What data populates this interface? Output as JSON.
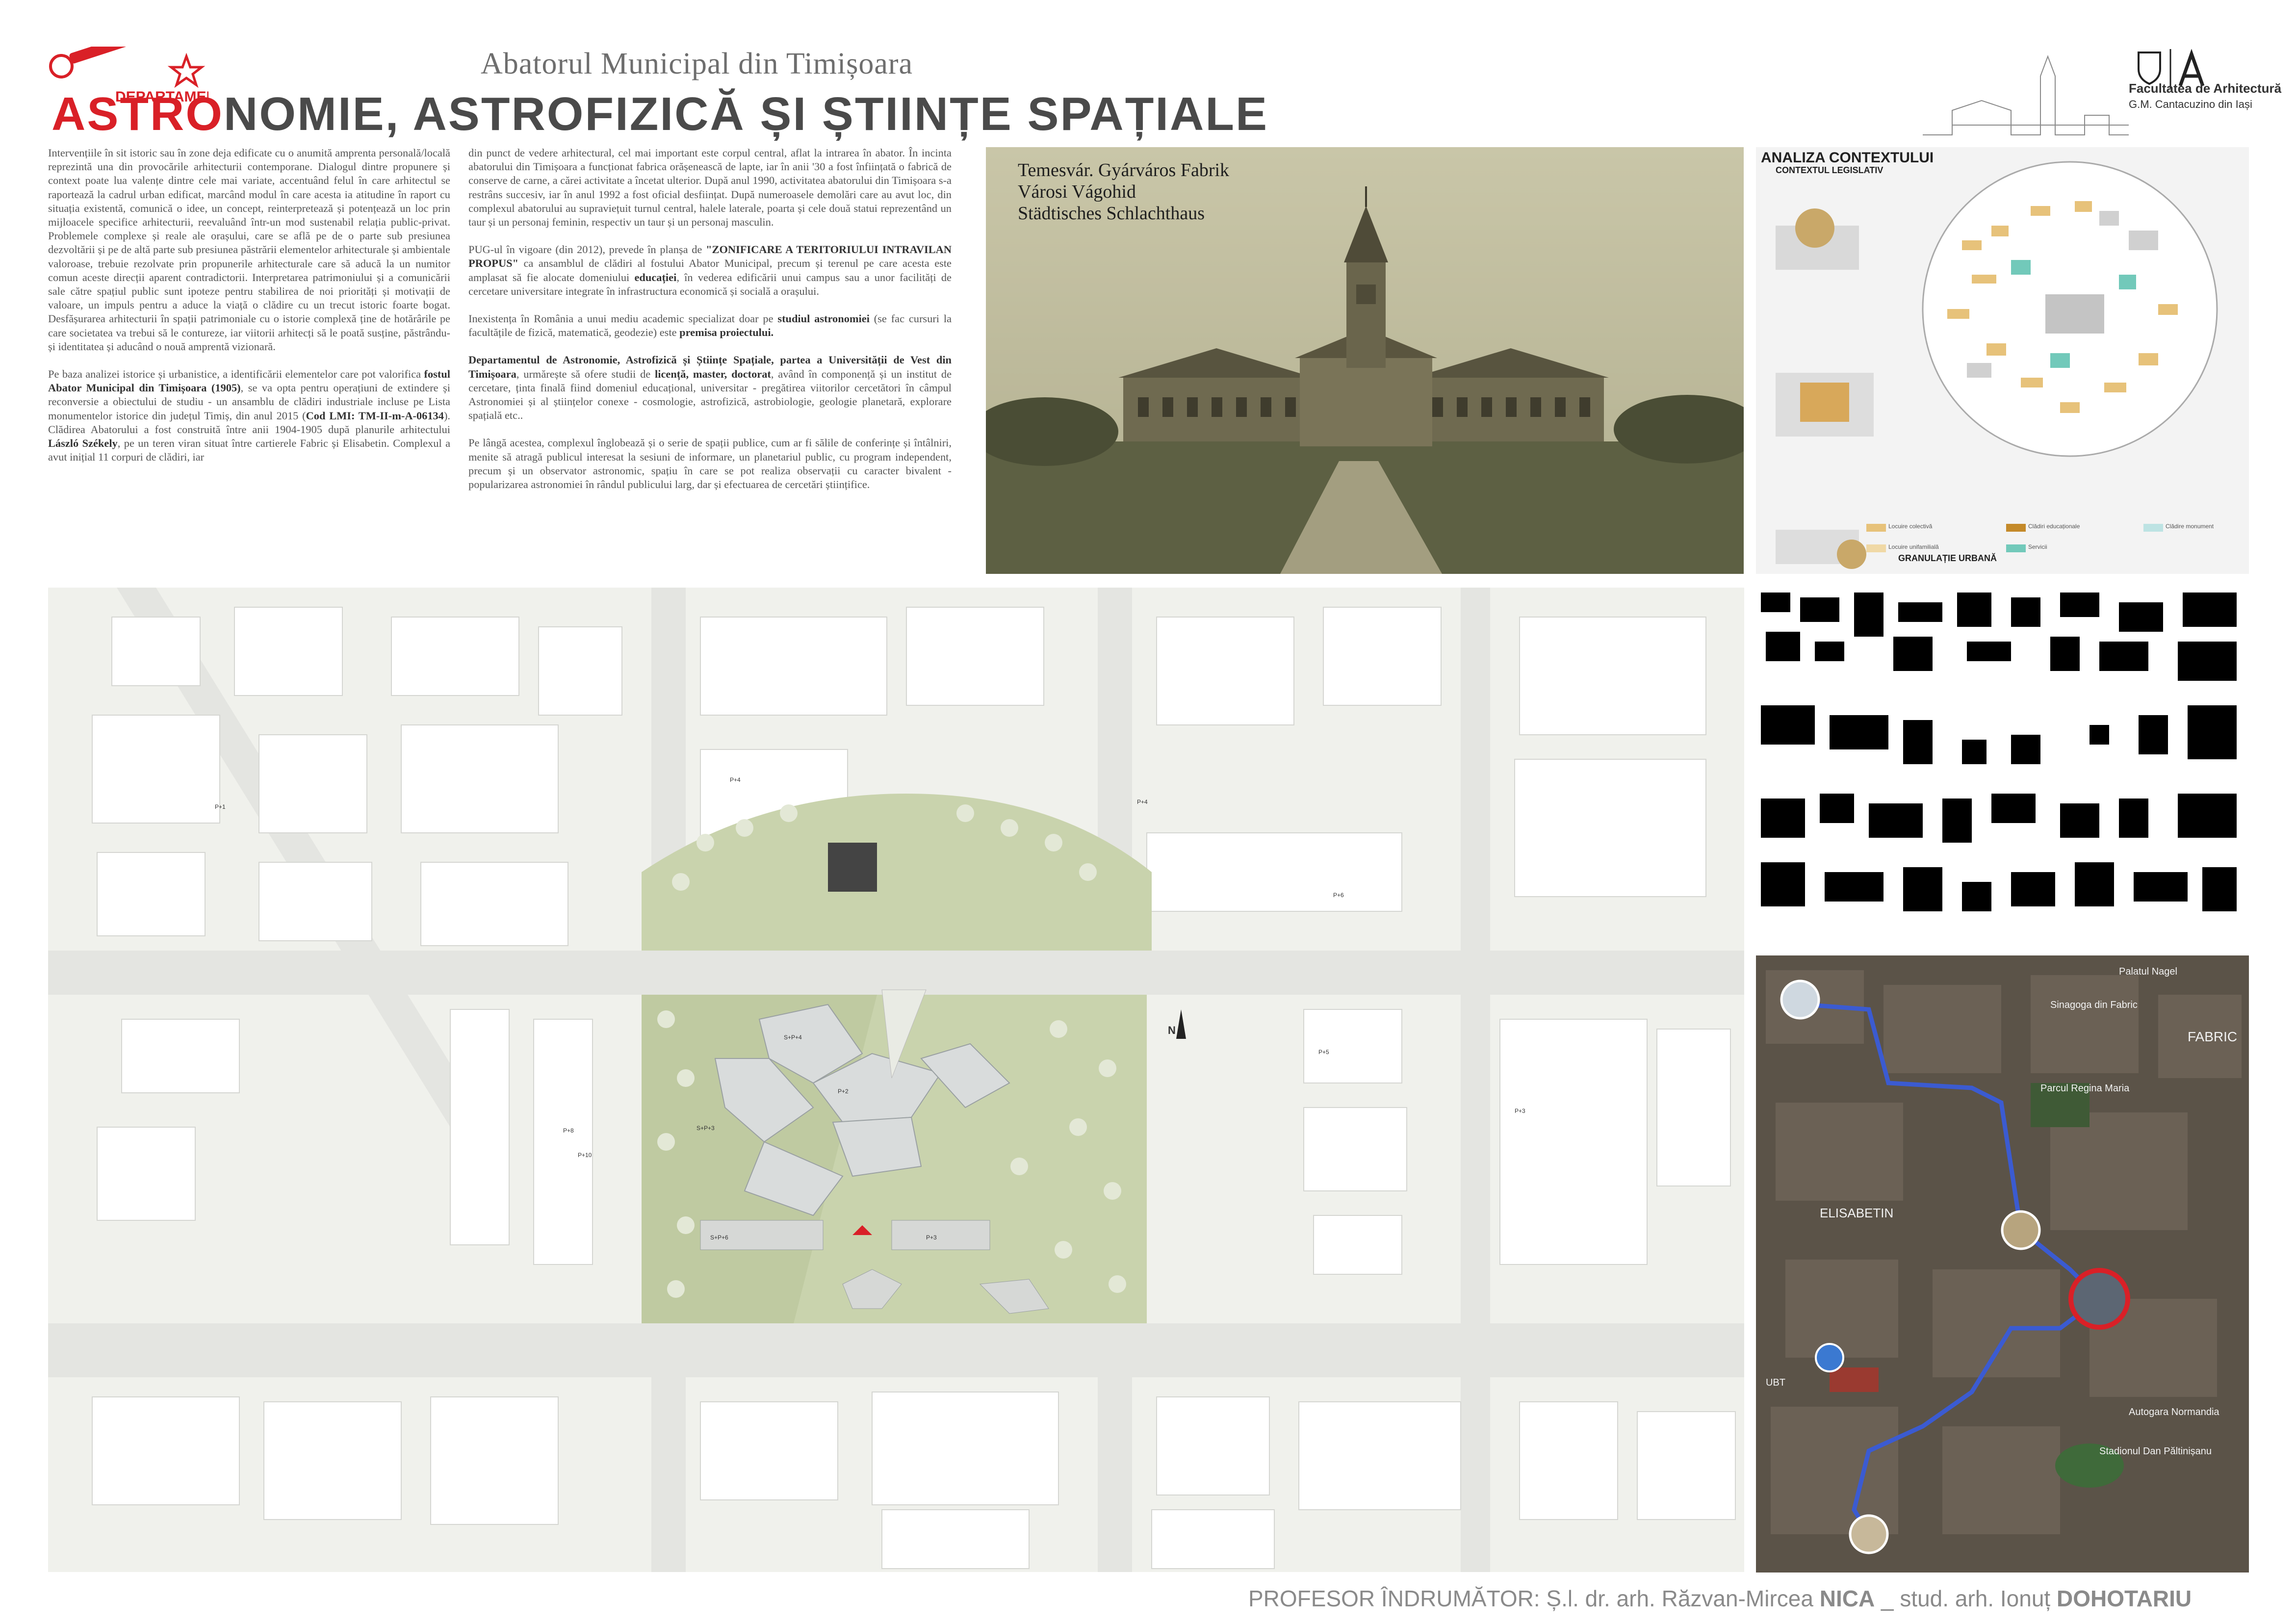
{
  "header": {
    "logo_text": "DEPARTAMENTUL",
    "subtitle": "Abatorul Municipal din Timișoara",
    "title_red": "ASTRO",
    "title_rest": "NOMIE, ASTROFIZICĂ ȘI ȘTIINȚE SPAȚIALE",
    "faculty_name": "Facultatea de Arhitectură",
    "faculty_sub": "G.M. Cantacuzino din Iași"
  },
  "text": {
    "col1_p1": "Intervențiile în sit istoric sau în zone deja edificate cu o anumită amprenta personală/locală reprezintă una din provocările arhitecturii contemporane. Dialogul dintre propunere și context poate lua valențe dintre cele mai variate, accentuând felul în care arhitectul se raportează la cadrul urban edificat, marcând modul în care acesta ia atitudine în raport cu situația existentă, comunică o idee, un concept, reinterpretează și potențează un loc prin mijloacele specifice arhitecturii, reevaluând într-un mod sustenabil relația public-privat. Problemele complexe și reale ale orașului, care se află pe de o parte sub presiunea dezvoltării și pe de altă parte sub presiunea păstrării elementelor arhitecturale și ambientale valoroase, trebuie rezolvate prin propunerile arhitecturale care să aducă la un numitor comun aceste direcții aparent contradictorii. Interpretarea patrimoniului și a comunicării sale către spațiul public sunt ipoteze pentru stabilirea de noi priorități și motivații de valoare, un impuls pentru a aduce la viață o clădire cu un trecut istoric foarte bogat. Desfășurarea arhitecturii în spații patrimoniale cu o istorie complexă ține de hotărârile pe care societatea va trebui să le contureze, iar viitorii arhitecți să le poată susține, păstrându-și identitatea și aducând o nouă amprentă vizionară.",
    "col1_p2a": "Pe baza analizei istorice și urbanistice, a identificării elementelor care pot valorifica ",
    "col1_p2b": "fostul Abator Municipal din Timișoara (1905)",
    "col1_p2c": ", se va opta pentru operațiuni de extindere și reconversie a obiectului de studiu - un ansamblu de clădiri industriale incluse pe Lista monumentelor istorice din județul Timiș, din anul 2015 (",
    "col1_p2d": "Cod LMI: TM-II-m-A-06134",
    "col1_p2e": "). Clădirea Abatorului a fost construită între anii 1904-1905 după planurile arhitectului ",
    "col1_p2f": "László Székely",
    "col1_p2g": ", pe un teren viran situat între cartierele Fabric și Elisabetin. Complexul a avut inițial 11 corpuri de clădiri, iar",
    "col2_p1": "din punct de vedere arhitectural, cel mai important este corpul central, aflat la intrarea în abator. În incinta abatorului din Timișoara a funcționat fabrica orășenească de lapte, iar în anii '30 a fost înființată o fabrică de conserve de carne, a cărei activitate a încetat ulterior. După anul 1990, activitatea abatorului din Timișoara s-a restrâns succesiv, iar în anul 1992 a fost oficial desființat. După numeroasele demolări care au avut loc, din complexul abatorului au supraviețuit turnul central, halele laterale, poarta și cele două statui reprezentând un taur și un personaj feminin, respectiv un taur și un personaj masculin.",
    "col2_p2a": "PUG-ul în vigoare (din 2012), prevede în planșa de ",
    "col2_p2b": "\"ZONIFICARE A TERITORIULUI INTRAVILAN PROPUS\"",
    "col2_p2c": " ca ansamblul de clădiri al fostului Abator Municipal, precum și terenul pe care acesta este amplasat să fie alocate domeniului ",
    "col2_p2d": "educației",
    "col2_p2e": ", în vederea edificării unui campus sau a unor facilități de cercetare universitare integrate în infrastructura economică și socială a orașului.",
    "col2_p3a": "Inexistența în România a unui mediu academic specializat doar pe ",
    "col2_p3b": "studiul astronomiei",
    "col2_p3c": " (se fac cursuri la facultățile de fizică, matematică, geodezie) este ",
    "col2_p3d": "premisa proiectului.",
    "col2_p4a": "Departamentul de Astronomie, Astrofizică și Științe Spațiale, partea a Universității de Vest din Timișoara",
    "col2_p4b": ", urmărește să ofere studii de ",
    "col2_p4c": "licență, master, doctorat",
    "col2_p4d": ", având în componență și un institut de cercetare, ținta finală fiind domeniul educațional, universitar - pregătirea viitorilor cercetători în câmpul Astronomiei și al științelor conexe - cosmologie, astrofizică, astrobiologie, geologie planetară, explorare spațială etc..",
    "col2_p5": "Pe lângă acestea, complexul înglobează și o serie de spații publice, cum ar fi sălile de conferințe și întâlniri, menite să atragă publicul interesat la sesiuni de informare, un planetariul public, cu program independent, precum și un observator astronomic, spațiu în care se pot realiza observații cu caracter bivalent - popularizarea astronomiei în rândul publicului larg, dar și efectuarea de cercetări științifice."
  },
  "photo": {
    "caption_l1": "Temesvár.  Gyárváros Fabrik",
    "caption_l2": "Városi Vágohid",
    "caption_l3": "Städtisches Schlachthaus"
  },
  "context": {
    "title": "ANALIZA CONTEXTULUI",
    "subtitle": "CONTEXTUL LEGISLATIV",
    "granulation": "GRANULAȚIE URBANĂ",
    "legend": [
      "Locuire colectivă",
      "Clădire monument",
      "Clădiri educaționale",
      "Locuire unifamilială",
      "Servicii"
    ]
  },
  "plan": {
    "labels": [
      "P+1",
      "P+3",
      "P+2",
      "P+4",
      "P+5",
      "P+6",
      "P+7",
      "P+8",
      "S+P+3",
      "S+P+4",
      "S+P+6",
      "P+6",
      "P+4",
      "P+3",
      "P+10"
    ],
    "north": "N"
  },
  "map": {
    "labels": [
      "Palatul Nagel",
      "FABRIC",
      "ELISABETIN",
      "Parcul Regina Maria",
      "Sinagoga din Fabric",
      "Stadionul Dan Păltinișanu",
      "Autogara Normandia",
      "UBT"
    ]
  },
  "footer": {
    "prefix": "PROFESOR ÎNDRUMĂTOR: Ș.l. dr. arh. Răzvan-Mircea ",
    "prof": "NICA",
    "mid": " _ stud. arh. Ionuț ",
    "student": "DOHOTARIU"
  },
  "colors": {
    "accent_red": "#d92027",
    "title_grey": "#4a4a4a",
    "route_blue": "#3b5bd1",
    "park_green": "#c9d3ad"
  }
}
